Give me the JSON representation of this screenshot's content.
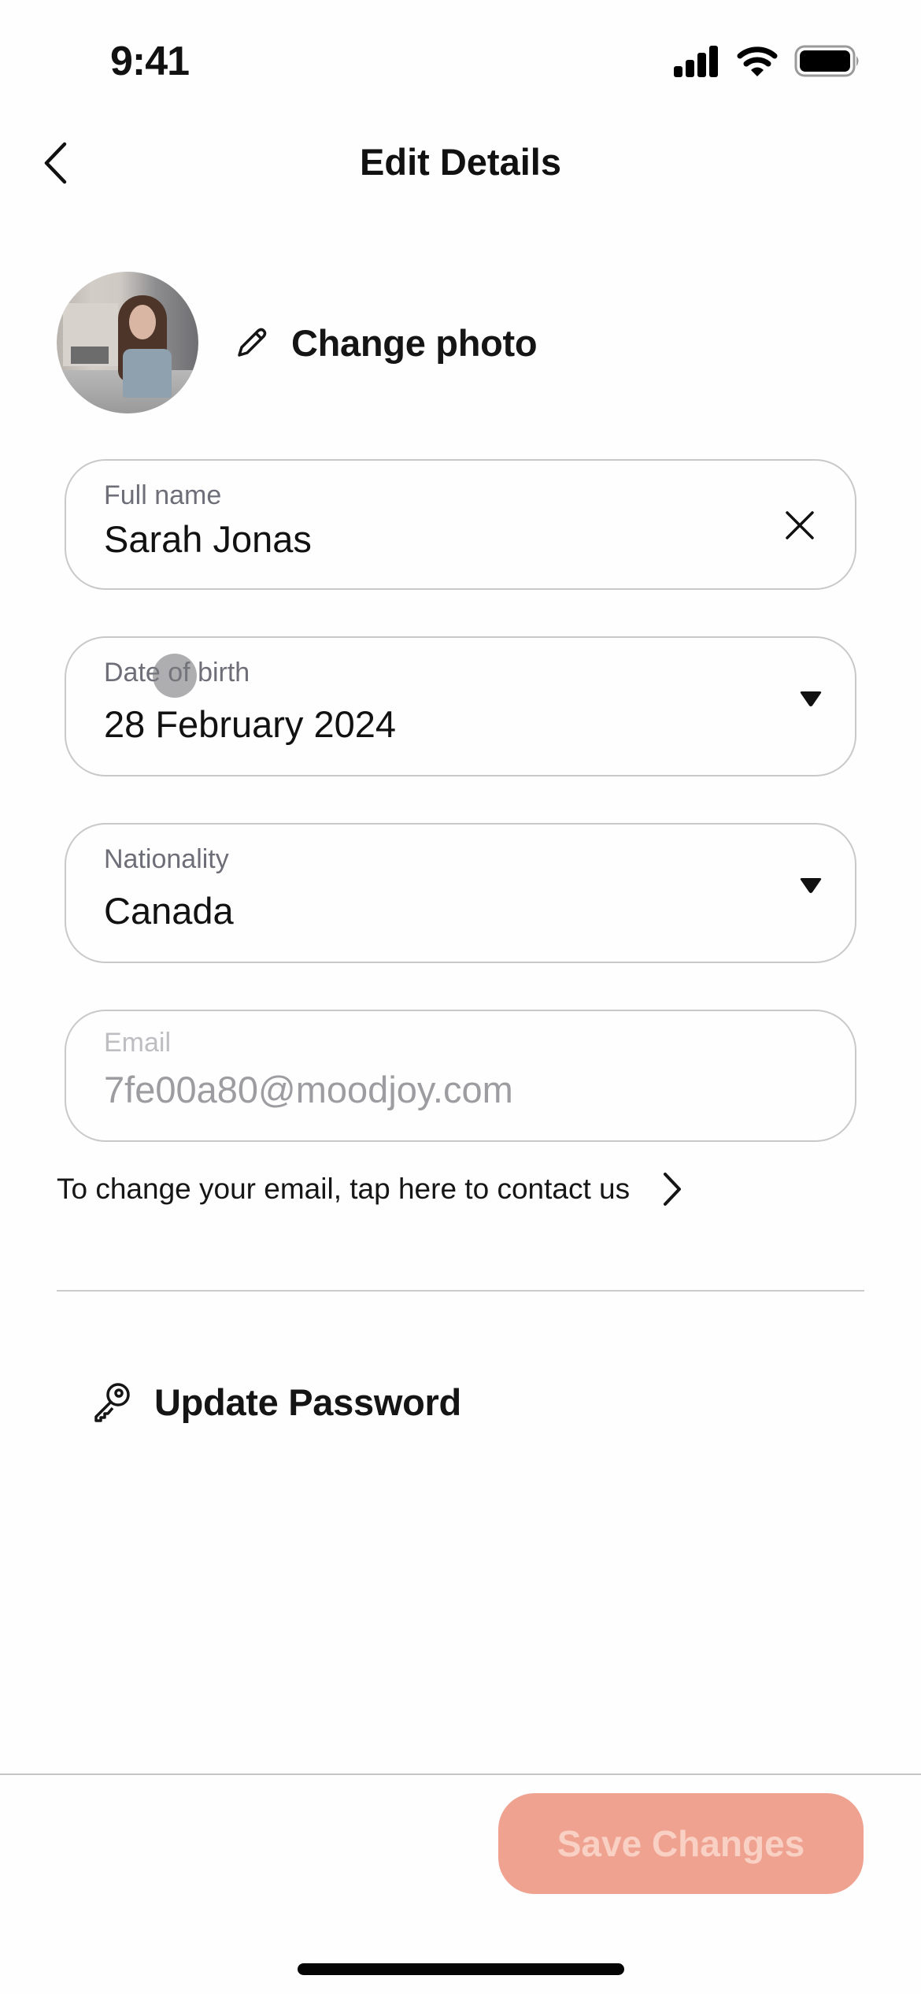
{
  "status_bar": {
    "time": "9:41",
    "icons": [
      "cellular-signal-icon",
      "wifi-icon",
      "battery-icon"
    ]
  },
  "nav": {
    "back_icon": "chevron-left-icon",
    "title": "Edit Details"
  },
  "profile": {
    "avatar_alt": "Profile photo",
    "change_photo_icon": "pencil-icon",
    "change_photo_label": "Change photo"
  },
  "form": {
    "full_name": {
      "label": "Full name",
      "value": "Sarah Jonas",
      "action_icon": "clear-x-icon"
    },
    "date_of_birth": {
      "label": "Date of birth",
      "value": "28 February 2024",
      "action_icon": "dropdown-caret-icon"
    },
    "nationality": {
      "label": "Nationality",
      "value": "Canada",
      "action_icon": "dropdown-caret-icon"
    },
    "email": {
      "label": "Email",
      "value": "7fe00a80@moodjoy.com",
      "disabled": true
    },
    "email_help_link": "To change your email, tap here to contact us"
  },
  "security": {
    "update_password_icon": "key-icon",
    "update_password_label": "Update Password"
  },
  "footer": {
    "save_label": "Save Changes",
    "save_enabled": false
  },
  "colors": {
    "save_button_bg": "#F0A291",
    "save_button_text": "#F9D0C4",
    "field_border": "#C9C9CC",
    "label_text": "#6E6E78",
    "disabled_text": "#9C9CA1"
  }
}
